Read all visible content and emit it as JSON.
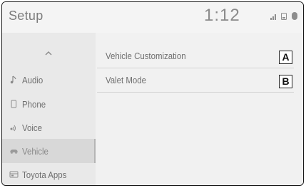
{
  "header": {
    "title": "Setup",
    "time": "1:12"
  },
  "status_icons": [
    "signal-icon",
    "phone-icon",
    "bluetooth-icon"
  ],
  "sidebar": {
    "scroll_up_icon": "chevron-up-icon",
    "items": [
      {
        "label": "Audio",
        "icon": "music-note-icon",
        "selected": false
      },
      {
        "label": "Phone",
        "icon": "phone-icon",
        "selected": false
      },
      {
        "label": "Voice",
        "icon": "voice-icon",
        "selected": false
      },
      {
        "label": "Vehicle",
        "icon": "car-icon",
        "selected": true
      },
      {
        "label": "Toyota Apps",
        "icon": "apps-icon",
        "selected": false
      }
    ]
  },
  "main": {
    "items": [
      {
        "label": "Vehicle Customization",
        "badge": "A"
      },
      {
        "label": "Valet Mode",
        "badge": "B"
      }
    ]
  }
}
